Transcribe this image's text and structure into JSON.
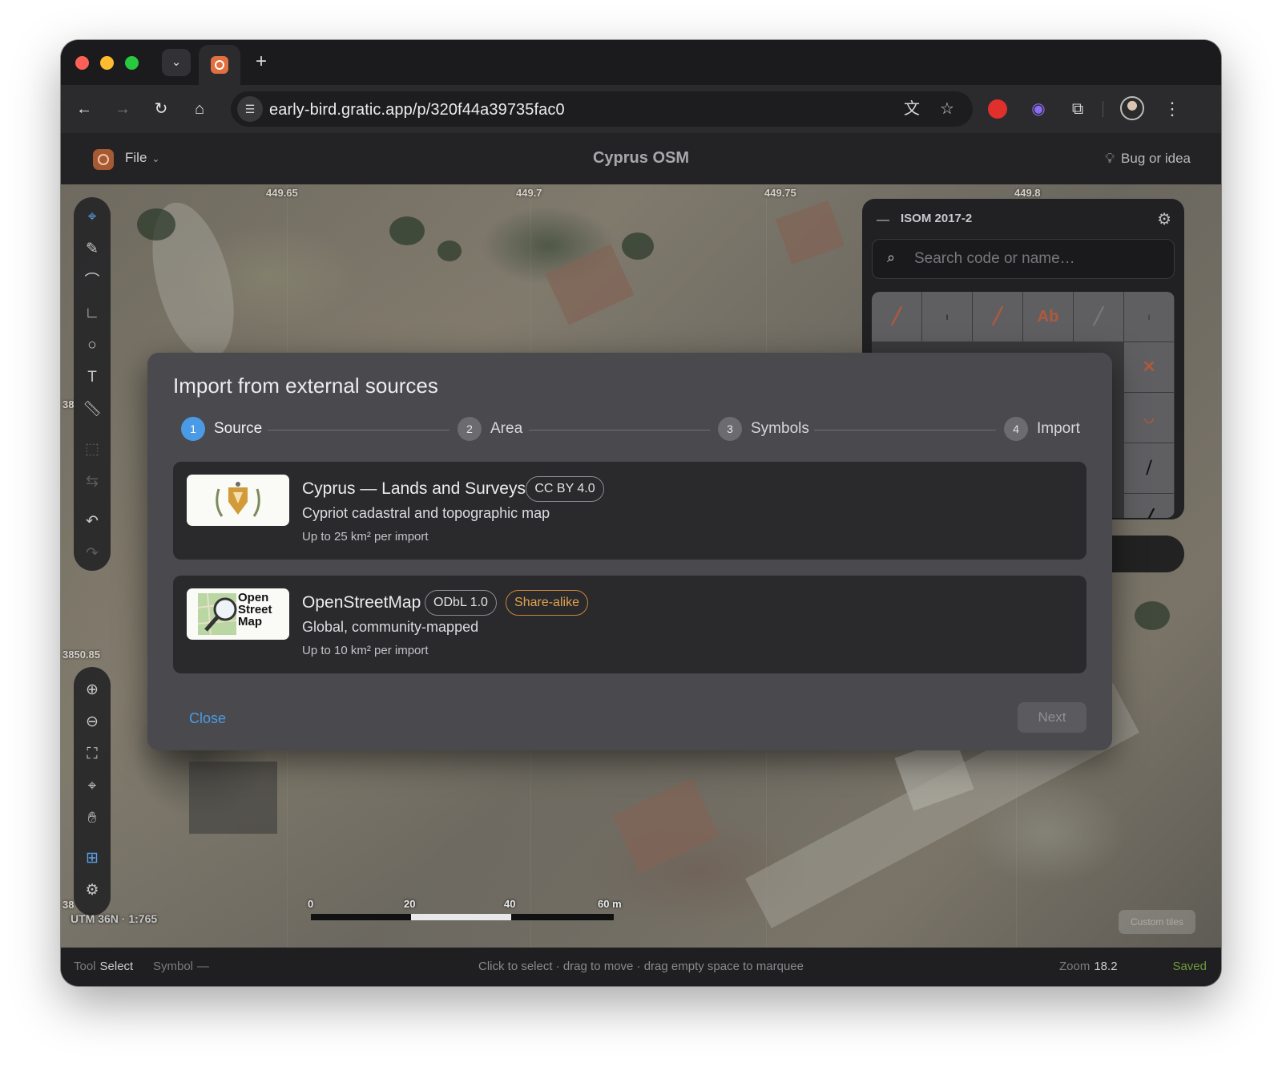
{
  "browser": {
    "url": "early-bird.gratic.app/p/320f44a39735fac0",
    "new_tab": "+"
  },
  "app": {
    "file_menu": "File",
    "title": "Cyprus OSM",
    "feedback": "Bug or idea"
  },
  "map": {
    "coord_labels_top": [
      "449.65",
      "449.7",
      "449.75",
      "449.8"
    ],
    "coord_label_left_1": "38",
    "coord_label_left_2": "3850.85",
    "coord_label_left_3": "38",
    "projection": "UTM 36N · 1:765",
    "scale": [
      "0",
      "20",
      "40",
      "60 m"
    ],
    "custom_button": "Custom tiles"
  },
  "symbol_panel": {
    "title": "ISOM 2017-2",
    "search_placeholder": "Search code or name…",
    "text_symbol": "Ab"
  },
  "status_bar": {
    "tool_key": "Tool",
    "tool_value": "Select",
    "symbol_key": "Symbol",
    "symbol_value": "—",
    "hint": "Click to select · drag to move · drag empty space to marquee",
    "zoom_key": "Zoom",
    "zoom_value": "18.2",
    "save_state": "Saved"
  },
  "modal": {
    "title": "Import from external sources",
    "steps": [
      {
        "num": "1",
        "label": "Source"
      },
      {
        "num": "2",
        "label": "Area"
      },
      {
        "num": "3",
        "label": "Symbols"
      },
      {
        "num": "4",
        "label": "Import"
      }
    ],
    "sources": [
      {
        "name": "Cyprus — Lands and Surveys",
        "license": "CC BY 4.0",
        "description": "Cypriot cadastral and topographic map",
        "limit": "Up to 25 km² per import"
      },
      {
        "name": "OpenStreetMap",
        "license": "ODbL 1.0",
        "extra_badge": "Share-alike",
        "description": "Global, community-mapped",
        "limit": "Up to 10 km² per import",
        "logo_text": [
          "Open",
          "Street",
          "Map"
        ]
      }
    ],
    "close": "Close",
    "next": "Next"
  },
  "colors": {
    "accent": "#4a9ae6",
    "share_alike": "#e3a24e",
    "saved": "#6f9a3c"
  }
}
